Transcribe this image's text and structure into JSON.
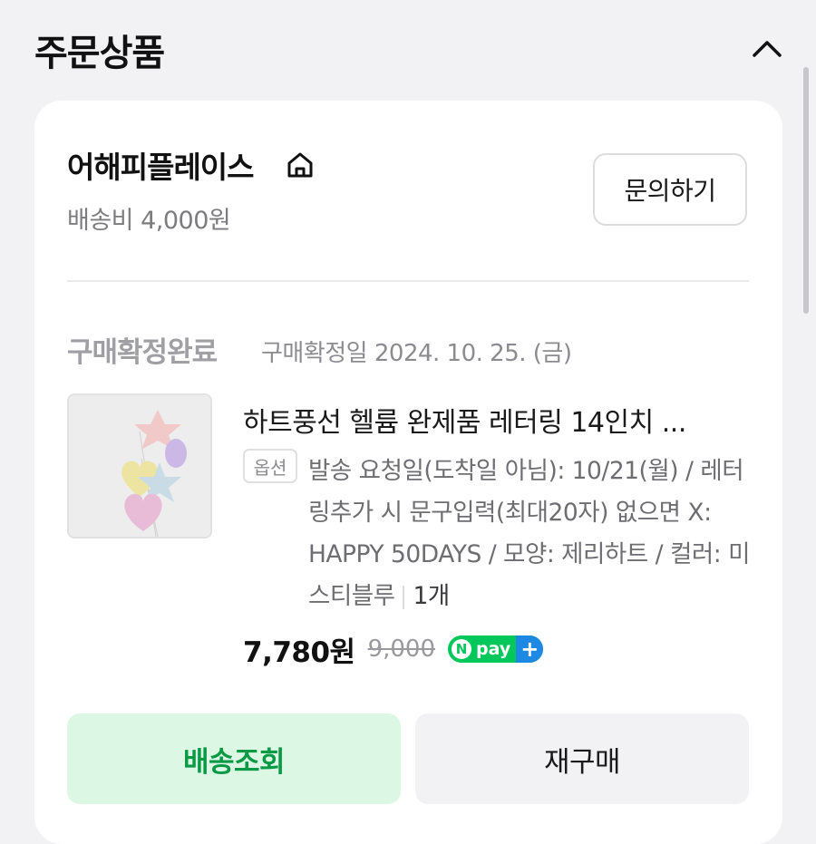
{
  "section": {
    "title": "주문상품",
    "collapse_icon": "chevron-up-icon"
  },
  "store": {
    "name": "어해피플레이스",
    "home_icon": "home-icon",
    "shipping_fee": "배송비 4,000원",
    "inquiry_label": "문의하기"
  },
  "order": {
    "status": "구매확정완료",
    "confirm_date": "구매확정일 2024. 10. 25. (금)"
  },
  "product": {
    "name": "하트풍선 헬륨 완제품 레터링 14인치 ...",
    "option_badge": "옵션",
    "option_text": "발송 요청일(도착일 아님): 10/21(월) / 레터링추가 시 문구입력(최대20자) 없으면 X: HAPPY 50DAYS / 모양: 제리하트 / 컬러: 미스티블루",
    "quantity": "1개",
    "price": "7,780원",
    "original_price": "9,000",
    "npay_n": "N",
    "npay_label": "pay",
    "npay_plus": "+"
  },
  "actions": {
    "track_label": "배송조회",
    "rebuy_label": "재구매"
  },
  "colors": {
    "accent_green": "#03c75a",
    "track_text": "#0a9a46",
    "track_bg": "#dcf7e4",
    "npay_plus_blue": "#1e88e5"
  }
}
